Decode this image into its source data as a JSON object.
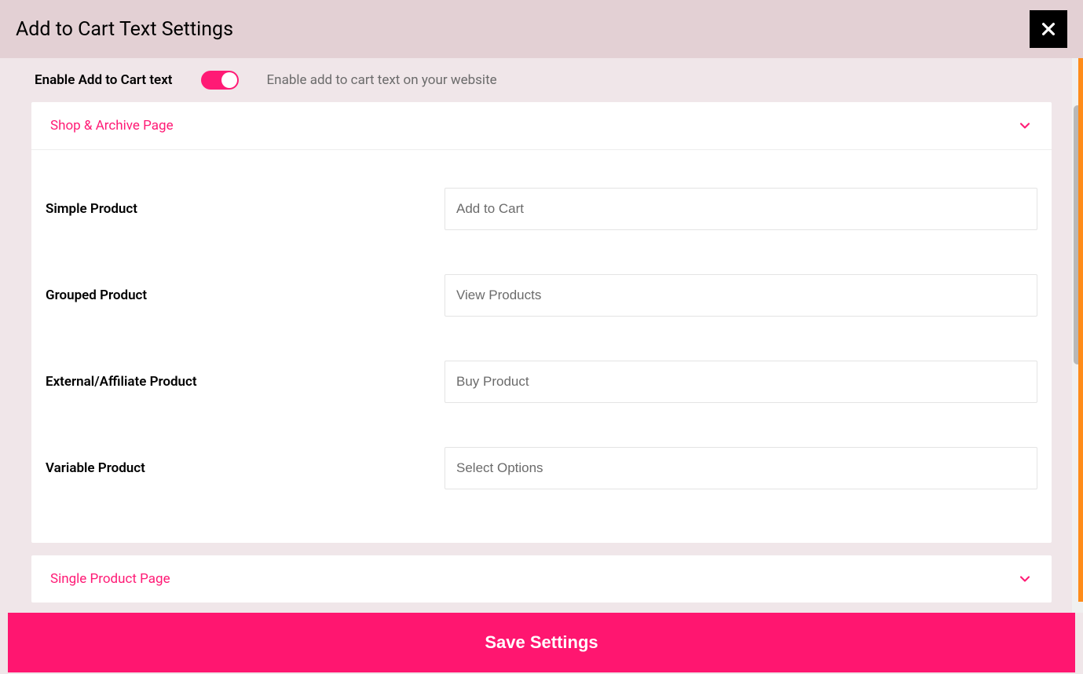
{
  "modal": {
    "title": "Add to Cart Text Settings"
  },
  "enable": {
    "label": "Enable Add to Cart text",
    "description": "Enable add to cart text on your website",
    "value": true
  },
  "sections": {
    "shopArchive": {
      "title": "Shop & Archive Page",
      "fields": {
        "simple": {
          "label": "Simple Product",
          "placeholder": "Add to Cart",
          "value": ""
        },
        "grouped": {
          "label": "Grouped Product",
          "placeholder": "View Products",
          "value": ""
        },
        "external": {
          "label": "External/Affiliate Product",
          "placeholder": "Buy Product",
          "value": ""
        },
        "variable": {
          "label": "Variable Product",
          "placeholder": "Select Options",
          "value": ""
        }
      }
    },
    "singleProduct": {
      "title": "Single Product Page"
    }
  },
  "footer": {
    "saveLabel": "Save Settings"
  },
  "colors": {
    "accent": "#ff1a75",
    "headerBg": "#e3d0d4",
    "bodyBg": "#f0e6e9",
    "orange": "#ff8c1a"
  }
}
